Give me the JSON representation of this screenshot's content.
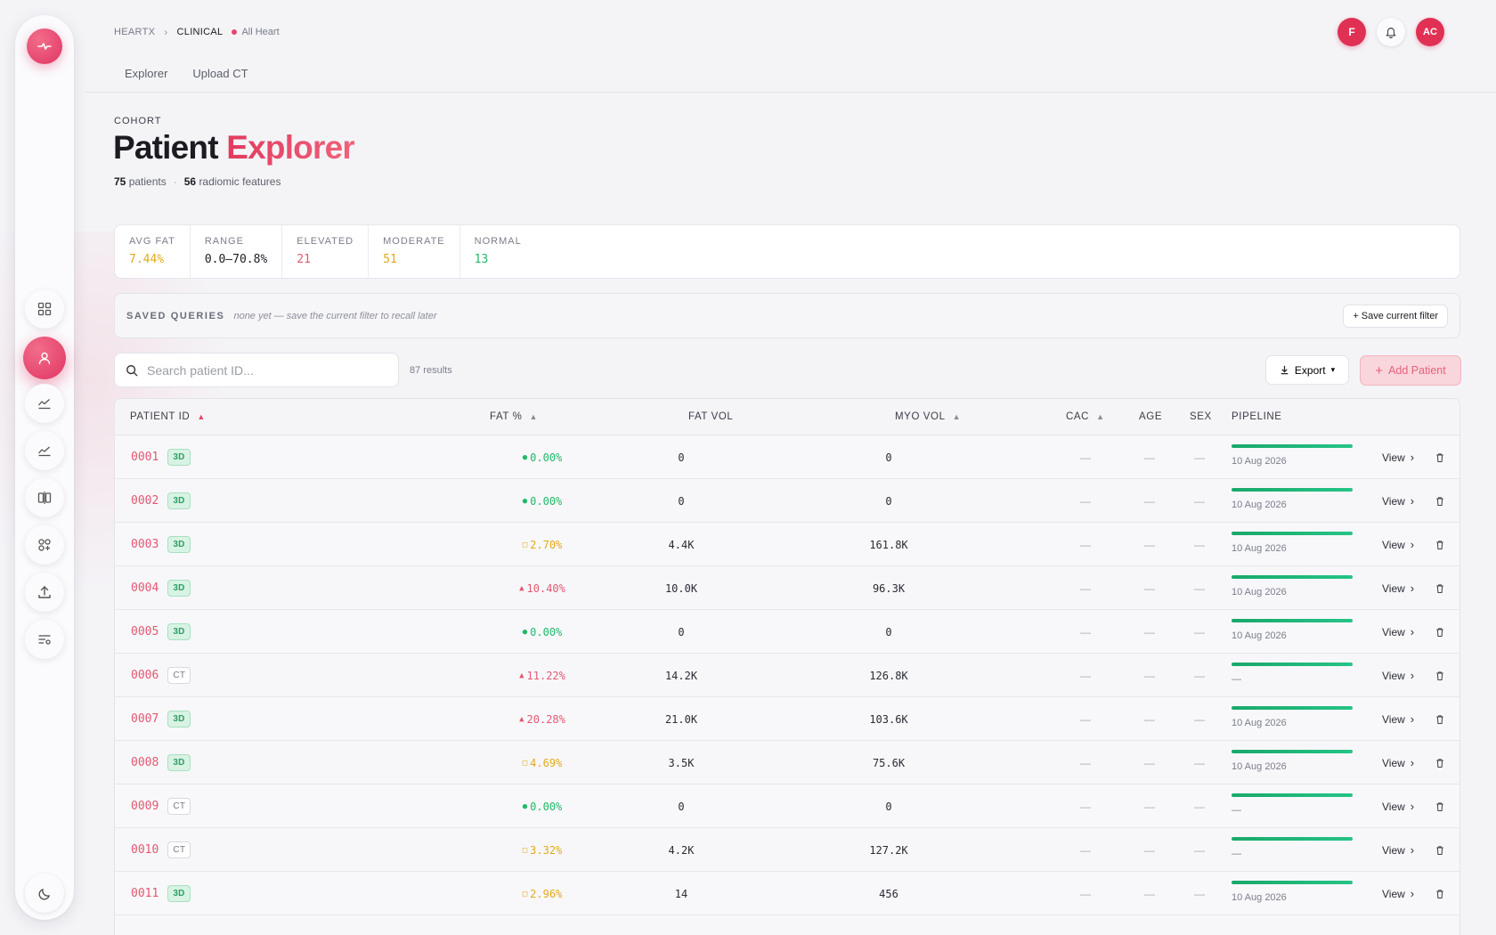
{
  "breadcrumb": {
    "root": "HEARTX",
    "current": "CLINICAL",
    "scope": "All Heart"
  },
  "header": {
    "user_initial": "F",
    "account_initials": "AC"
  },
  "tabs": [
    {
      "label": "Explorer"
    },
    {
      "label": "Upload CT"
    }
  ],
  "page": {
    "eyebrow": "COHORT",
    "title_main": "Patient",
    "title_accent": "Explorer",
    "patients_count": "75",
    "patients_label": "patients",
    "features_count": "56",
    "features_label": "radiomic features",
    "separator": "·"
  },
  "stats": [
    {
      "label": "AVG FAT",
      "value": "7.44%",
      "color": "#e2a91a"
    },
    {
      "label": "RANGE",
      "value": "0.0–70.8%",
      "color": "#1b1b22"
    },
    {
      "label": "ELEVATED",
      "value": "21",
      "color": "#e2586f"
    },
    {
      "label": "MODERATE",
      "value": "51",
      "color": "#e2a91a"
    },
    {
      "label": "NORMAL",
      "value": "13",
      "color": "#22b866"
    }
  ],
  "saved_queries": {
    "label": "SAVED QUERIES",
    "hint": "none yet — save the current filter to recall later",
    "save_button": "+ Save current filter"
  },
  "search": {
    "placeholder": "Search patient ID...",
    "value": "",
    "results": "87 results"
  },
  "toolbar": {
    "export_label": "Export",
    "add_label": "Add Patient"
  },
  "table": {
    "columns": {
      "patient_id": "PATIENT ID",
      "fat_pct": "FAT %",
      "fat_vol": "FAT VOL",
      "myo_vol": "MYO VOL",
      "cac": "CAC",
      "age": "AGE",
      "sex": "SEX",
      "pipeline": "PIPELINE"
    },
    "view_label": "View",
    "rows": [
      {
        "id": "0001",
        "mod": "3D",
        "fat": "0.00%",
        "lvl": "normal",
        "fat_vol": "0",
        "myo_vol": "0",
        "cac": "—",
        "age": "—",
        "sex": "—",
        "pipeline_date": "10 Aug 2026"
      },
      {
        "id": "0002",
        "mod": "3D",
        "fat": "0.00%",
        "lvl": "normal",
        "fat_vol": "0",
        "myo_vol": "0",
        "cac": "—",
        "age": "—",
        "sex": "—",
        "pipeline_date": "10 Aug 2026"
      },
      {
        "id": "0003",
        "mod": "3D",
        "fat": "2.70%",
        "lvl": "moderate",
        "fat_vol": "4.4K",
        "myo_vol": "161.8K",
        "cac": "—",
        "age": "—",
        "sex": "—",
        "pipeline_date": "10 Aug 2026"
      },
      {
        "id": "0004",
        "mod": "3D",
        "fat": "10.40%",
        "lvl": "elevated",
        "fat_vol": "10.0K",
        "myo_vol": "96.3K",
        "cac": "—",
        "age": "—",
        "sex": "—",
        "pipeline_date": "10 Aug 2026"
      },
      {
        "id": "0005",
        "mod": "3D",
        "fat": "0.00%",
        "lvl": "normal",
        "fat_vol": "0",
        "myo_vol": "0",
        "cac": "—",
        "age": "—",
        "sex": "—",
        "pipeline_date": "10 Aug 2026"
      },
      {
        "id": "0006",
        "mod": "CT",
        "fat": "11.22%",
        "lvl": "elevated",
        "fat_vol": "14.2K",
        "myo_vol": "126.8K",
        "cac": "—",
        "age": "—",
        "sex": "—",
        "pipeline_date": "—"
      },
      {
        "id": "0007",
        "mod": "3D",
        "fat": "20.28%",
        "lvl": "elevated",
        "fat_vol": "21.0K",
        "myo_vol": "103.6K",
        "cac": "—",
        "age": "—",
        "sex": "—",
        "pipeline_date": "10 Aug 2026"
      },
      {
        "id": "0008",
        "mod": "3D",
        "fat": "4.69%",
        "lvl": "moderate",
        "fat_vol": "3.5K",
        "myo_vol": "75.6K",
        "cac": "—",
        "age": "—",
        "sex": "—",
        "pipeline_date": "10 Aug 2026"
      },
      {
        "id": "0009",
        "mod": "CT",
        "fat": "0.00%",
        "lvl": "normal",
        "fat_vol": "0",
        "myo_vol": "0",
        "cac": "—",
        "age": "—",
        "sex": "—",
        "pipeline_date": "—"
      },
      {
        "id": "0010",
        "mod": "CT",
        "fat": "3.32%",
        "lvl": "moderate",
        "fat_vol": "4.2K",
        "myo_vol": "127.2K",
        "cac": "—",
        "age": "—",
        "sex": "—",
        "pipeline_date": "—"
      },
      {
        "id": "0011",
        "mod": "3D",
        "fat": "2.96%",
        "lvl": "moderate",
        "fat_vol": "14",
        "myo_vol": "456",
        "cac": "—",
        "age": "—",
        "sex": "—",
        "pipeline_date": "10 Aug 2026"
      }
    ]
  },
  "colors": {
    "accent": "#e03563",
    "normal": "#22b866",
    "moderate": "#e2a91a",
    "elevated": "#e2586f"
  }
}
